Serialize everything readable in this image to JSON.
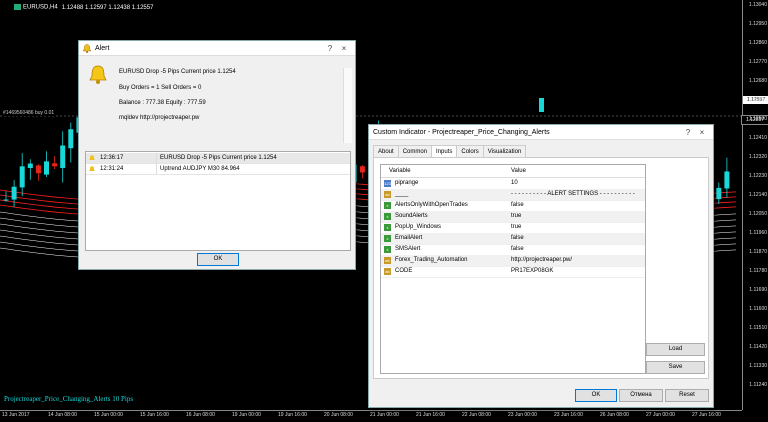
{
  "chart": {
    "title": "EURUSD,H4",
    "ohlc": "1.12488 1.12597 1.12438 1.12557",
    "hline_label": "#1469560486 buy 0.01",
    "indicator_label": "Projectreaper_Price_Changing_Alerts 10 Pips",
    "price_ticks": [
      "1.13040",
      "1.12950",
      "1.12860",
      "1.12770",
      "1.12680",
      "1.12590",
      "1.12500",
      "1.12410",
      "1.12320",
      "1.12230",
      "1.12140",
      "1.12050",
      "1.11960",
      "1.11870",
      "1.11780",
      "1.11690",
      "1.11600",
      "1.11510",
      "1.11420",
      "1.11330",
      "1.11240"
    ],
    "current_price_tag": "1.12557",
    "hline_price_tag": "1.12557",
    "time_ticks": [
      "13 Jun 2017",
      "14 Jun 08:00",
      "15 Jun 00:00",
      "15 Jun 16:00",
      "16 Jun 08:00",
      "19 Jun 00:00",
      "19 Jun 16:00",
      "20 Jun 08:00",
      "21 Jun 00:00",
      "21 Jun 16:00",
      "22 Jun 08:00",
      "23 Jun 00:00",
      "23 Jun 16:00",
      "26 Jun 08:00",
      "27 Jun 00:00",
      "27 Jun 16:00"
    ],
    "colors": {
      "bull": "#1ad8d8",
      "bear": "#e8241a",
      "band_red": "#ff2020",
      "band_white": "#ffffff",
      "background": "#000000"
    }
  },
  "alert": {
    "title": "Alert",
    "help": "?",
    "close": "×",
    "message_lines": [
      "EURUSD Drop -5 Pips  Current price 1.1254",
      "Buy Orders = 1 Sell Orders = 0",
      "Balance : 777.38  Equity : 777.59",
      "mqldev   http://projectreaper.pw"
    ],
    "list": [
      {
        "time": "12:36:17",
        "message": "EURUSD Drop -5 Pips  Current price 1.1254"
      },
      {
        "time": "12:31:24",
        "message": "Uptrend AUDJPY M30 84.964"
      }
    ],
    "ok_label": "OK"
  },
  "indicator_dialog": {
    "title": "Custom Indicator - Projectreaper_Price_Changing_Alerts",
    "help": "?",
    "close": "×",
    "tabs": [
      "About",
      "Common",
      "Inputs",
      "Colors",
      "Visualization"
    ],
    "active_tab": "Inputs",
    "columns": [
      "Variable",
      "Value"
    ],
    "rows": [
      {
        "type": "num",
        "variable": "piprange",
        "value": "10"
      },
      {
        "type": "str",
        "variable": "____",
        "value": "- - - - - - - - - - ALERT SETTINGS - - - - - - - - - -"
      },
      {
        "type": "bool",
        "variable": "AlertsOnlyWithOpenTrades",
        "value": "false"
      },
      {
        "type": "bool",
        "variable": "SoundAlerts",
        "value": "true"
      },
      {
        "type": "bool",
        "variable": "PopUp_Windows",
        "value": "true"
      },
      {
        "type": "bool",
        "variable": "EmailAlert",
        "value": "false"
      },
      {
        "type": "bool",
        "variable": "SMSAlert",
        "value": "false"
      },
      {
        "type": "str",
        "variable": "Forex_Trading_Automation",
        "value": "http://projectreaper.pw/"
      },
      {
        "type": "str",
        "variable": "CODE",
        "value": "PR17EXP08GK"
      }
    ],
    "type_icons": {
      "num": "123",
      "bool": "±",
      "str": "ab"
    },
    "load_label": "Load",
    "save_label": "Save",
    "ok_label": "OK",
    "cancel_label": "Отмена",
    "reset_label": "Reset"
  }
}
